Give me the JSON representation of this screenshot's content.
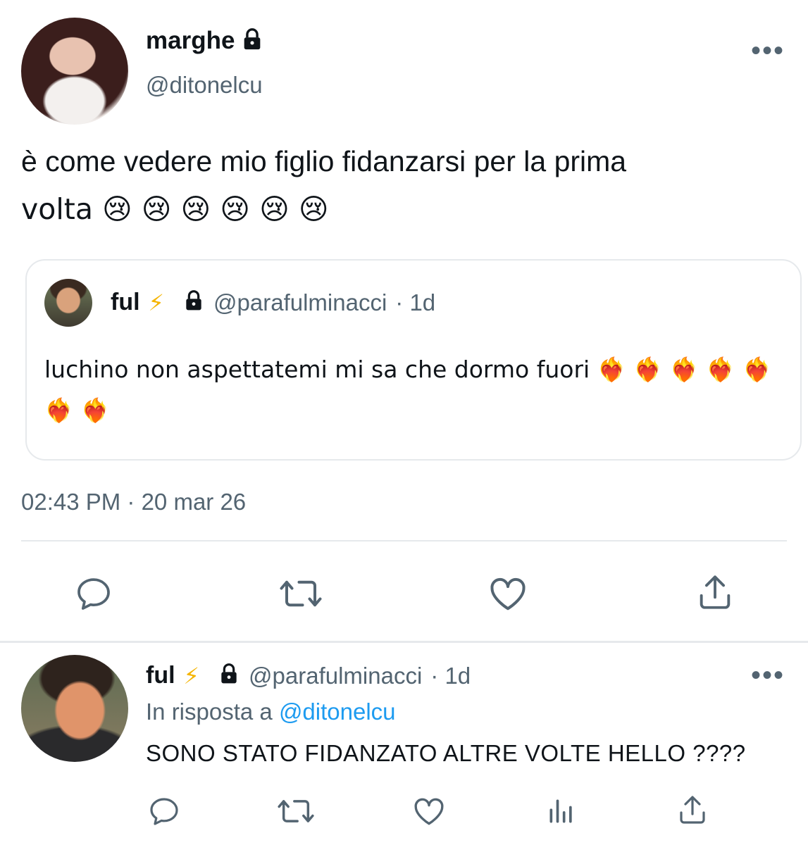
{
  "tweet": {
    "author_name": "marghe",
    "author_handle": "@ditonelcu",
    "text_line1": "è come vedere mio figlio fidanzarsi per la prima",
    "text_line2": "volta 😢 😢 😢 😢 😢 😢",
    "timestamp": "02:43 PM · 20 mar 26",
    "more_label": "•••"
  },
  "quoted": {
    "author_name": "ful",
    "bolt": "⚡",
    "author_handle": "@parafulminacci",
    "age": "· 1d",
    "text_line1": "luchino non aspettatemi mi sa che dormo fuori ❤️‍🔥 ❤️‍🔥 ❤️‍🔥 ❤️‍🔥 ❤️‍🔥",
    "text_line2": "❤️‍🔥 ❤️‍🔥"
  },
  "reply": {
    "author_name": "ful",
    "bolt": "⚡",
    "author_handle": "@parafulminacci",
    "age": "· 1d",
    "in_reply_prefix": "In risposta a",
    "in_reply_handle": "@ditonelcu",
    "text": "SONO STATO FIDANZATO ALTRE VOLTE HELLO ????",
    "more_label": "•••"
  },
  "icons": {
    "reply": "comment-icon",
    "retweet": "retweet-icon",
    "like": "heart-icon",
    "share": "share-icon",
    "views": "analytics-icon",
    "lock": "lock-icon"
  },
  "colors": {
    "text": "#0f1419",
    "secondary": "#536471",
    "link": "#1d9bf0",
    "bolt": "#f5b400",
    "divider": "#e6e9ec"
  }
}
